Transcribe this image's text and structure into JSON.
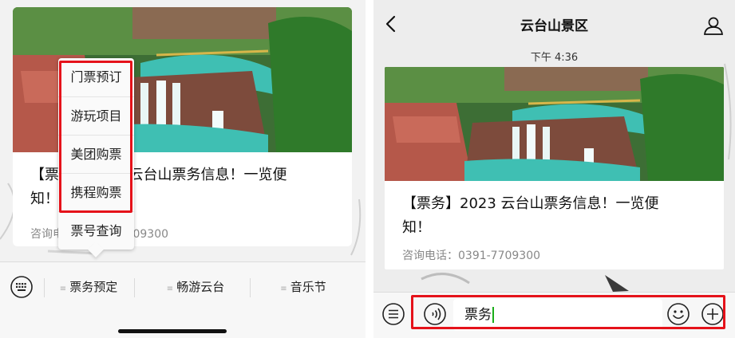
{
  "left": {
    "article": {
      "headline_line1": "【票务】2023 云台山票务信息！一览便",
      "headline_line2": "知！",
      "contact": "咨询电话：0391-7709300"
    },
    "popup_menu": {
      "items": [
        {
          "label": "门票预订"
        },
        {
          "label": "游玩项目"
        },
        {
          "label": "美团购票"
        },
        {
          "label": "携程购票"
        },
        {
          "label": "票号查询"
        }
      ]
    },
    "bottom_bar": {
      "tabs": [
        {
          "label": "票务预定"
        },
        {
          "label": "畅游云台"
        },
        {
          "label": "音乐节"
        }
      ]
    }
  },
  "right": {
    "header": {
      "title": "云台山景区"
    },
    "timestamp": "下午 4:36",
    "article": {
      "headline_line1": "【票务】2023 云台山票务信息！一览便",
      "headline_line2": "知！",
      "contact": "咨询电话：0391-7709300"
    },
    "input_bar": {
      "value": "票务"
    }
  },
  "colors": {
    "highlight": "#e5121a",
    "caret": "#1aad19",
    "water": "#3fbfb3",
    "rock": "#b5584a",
    "foliage": "#2f7a2a"
  }
}
